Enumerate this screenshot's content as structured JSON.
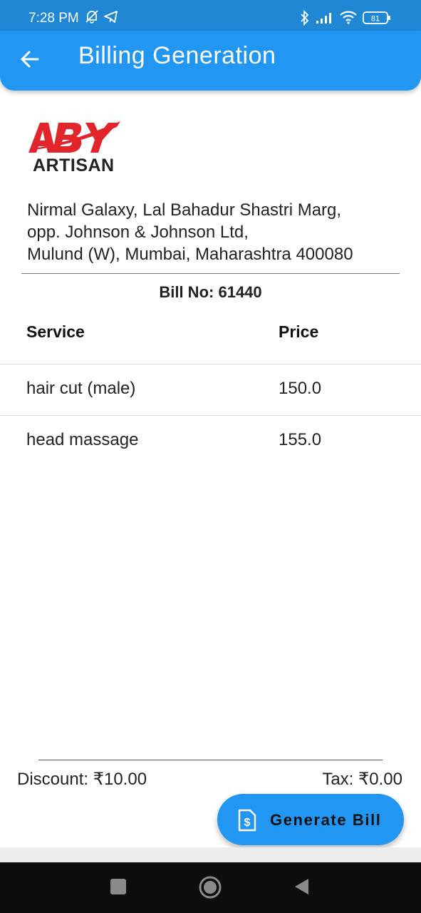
{
  "status_bar": {
    "time": "7:28 PM",
    "battery": "81",
    "icons": [
      "bell-off-icon",
      "telegram-icon",
      "bluetooth-icon",
      "signal-icon",
      "wifi-icon",
      "battery-icon"
    ]
  },
  "app_bar": {
    "title": "Billing Generation",
    "back_icon": "arrow-left-icon"
  },
  "logo": {
    "brand_mark": "ABY",
    "word": "ARTISAN",
    "brand_color": "#e0262b"
  },
  "address": {
    "line1": "Nirmal Galaxy, Lal Bahadur Shastri Marg,",
    "line2": "opp. Johnson & Johnson Ltd,",
    "line3": "Mulund (W), Mumbai, Maharashtra 400080"
  },
  "bill": {
    "label": "Bill No:",
    "number": "61440"
  },
  "table": {
    "headers": {
      "service": "Service",
      "price": "Price"
    },
    "rows": [
      {
        "service": "hair cut (male)",
        "price": "150.0"
      },
      {
        "service": "head massage",
        "price": "155.0"
      }
    ]
  },
  "summary": {
    "discount_label": "Discount: ₹10.00",
    "tax_label": "Tax: ₹0.00"
  },
  "fab": {
    "label": "Generate Bill",
    "icon": "invoice-dollar-icon"
  },
  "colors": {
    "status_bar": "#1f87d4",
    "app_bar": "#2196f3",
    "nav_bar": "#0d0d0d"
  },
  "nav": {
    "icons": [
      "recents-square-icon",
      "home-circle-icon",
      "back-triangle-icon"
    ]
  }
}
